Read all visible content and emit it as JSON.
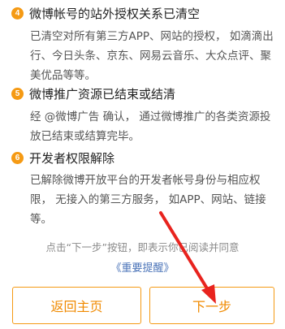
{
  "sections": [
    {
      "number": "4",
      "title": "微博帐号的站外授权关系已清空",
      "body_lines": [
        "已清空对所有第三方APP、网站的授权， 如滴滴出",
        "行、今日头条、京东、网易云音乐、大众点评、聚",
        "美优品等等。"
      ]
    },
    {
      "number": "5",
      "title": "微博推广资源已结束或结清",
      "body_lines": [
        "经 @微博广告 确认， 通过微博推广的各类资源投",
        "放已结束或结算完毕。"
      ]
    },
    {
      "number": "6",
      "title": "开发者权限解除",
      "body_lines": [
        "已解除微博开放平台的开发者帐号身份与相应权",
        "限， 无接入的第三方服务， 如APP、网站、链接",
        "等。"
      ]
    }
  ],
  "footer": {
    "hint": "点击“下一步”按钮，即表示你已阅读并同意",
    "reminder_link": "《重要提醒》"
  },
  "buttons": {
    "back_label": "返回主页",
    "next_label": "下一步"
  },
  "colors": {
    "accent": "#f59a14",
    "button_text": "#f08a00",
    "link": "#4a73b8",
    "arrow": "#e8231e"
  }
}
